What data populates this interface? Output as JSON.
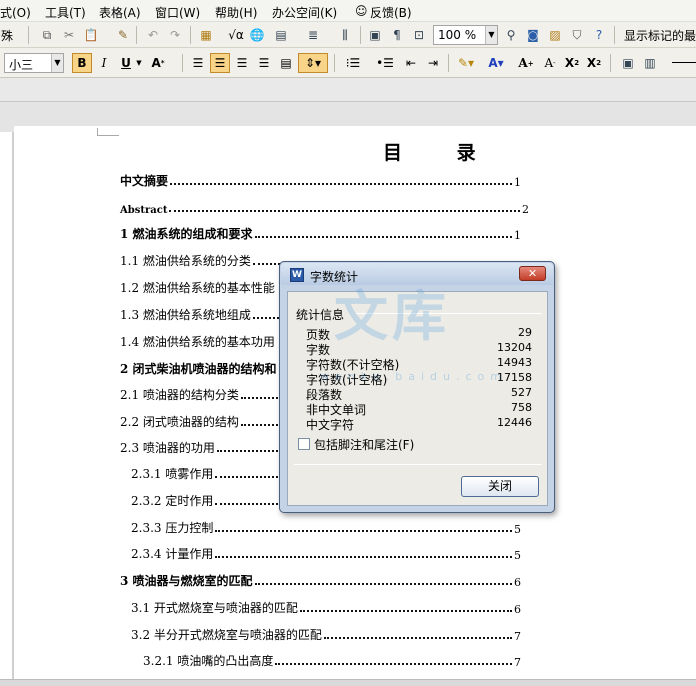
{
  "menus": [
    "式(O)",
    "工具(T)",
    "表格(A)",
    "窗口(W)",
    "帮助(H)",
    "办公空间(K)",
    "反馈(B)"
  ],
  "toolbar": {
    "zoom": "100 %",
    "markup_label": "显示标记的最",
    "font_size": "小三"
  },
  "document": {
    "title": "目  录",
    "toc": [
      {
        "text": "中文摘要",
        "page": "1",
        "bold": true
      },
      {
        "text": "Abstract",
        "page": "2",
        "bold": true
      },
      {
        "text": "1 燃油系统的组成和要求",
        "page": "1",
        "bold": true
      },
      {
        "text": "1.1 燃油供给系统的分类",
        "page": "",
        "bold": false
      },
      {
        "text": "1.2 燃油供给系统的基本性能",
        "page": "",
        "bold": false
      },
      {
        "text": "1.3 燃油供给系统地组成",
        "page": "",
        "bold": false
      },
      {
        "text": "1.4 燃油供给系统的基本功用",
        "page": "",
        "bold": false
      },
      {
        "text": "2 闭式柴油机喷油器的结构和",
        "page": "",
        "bold": true
      },
      {
        "text": "2.1  喷油器的结构分类",
        "page": "",
        "bold": false
      },
      {
        "text": "2.2 闭式喷油器的结构",
        "page": "",
        "bold": false
      },
      {
        "text": "2.3 喷油器的功用",
        "page": "",
        "bold": false
      },
      {
        "text": "2.3.1 喷雾作用",
        "page": "",
        "bold": false
      },
      {
        "text": "2.3.2  定时作用",
        "page": "",
        "bold": false
      },
      {
        "text": "2.3.3  压力控制",
        "page": "5",
        "bold": false
      },
      {
        "text": "2.3.4 计量作用",
        "page": "5",
        "bold": false
      },
      {
        "text": "3 喷油器与燃烧室的匹配",
        "page": "6",
        "bold": true
      },
      {
        "text": "3.1 开式燃烧室与喷油器的匹配",
        "page": "6",
        "bold": false
      },
      {
        "text": "3.2 半分开式燃烧室与喷油器的匹配",
        "page": "7",
        "bold": false
      },
      {
        "text": "3.2.1 喷油嘴的凸出高度",
        "page": "7",
        "bold": false
      }
    ]
  },
  "dialog": {
    "title": "字数统计",
    "group_label": "统计信息",
    "stats": [
      {
        "label": "页数",
        "value": "29"
      },
      {
        "label": "字数",
        "value": "13204"
      },
      {
        "label": "字符数(不计空格)",
        "value": "14943"
      },
      {
        "label": "字符数(计空格)",
        "value": "17158"
      },
      {
        "label": "段落数",
        "value": "527"
      },
      {
        "label": "非中文单词",
        "value": "758"
      },
      {
        "label": "中文字符",
        "value": "12446"
      }
    ],
    "checkbox_label": "包括脚注和尾注(F)",
    "checkbox_checked": false,
    "close_button": "关闭"
  },
  "watermark": {
    "brand": "文库",
    "url": "wenku.baidu.com"
  }
}
